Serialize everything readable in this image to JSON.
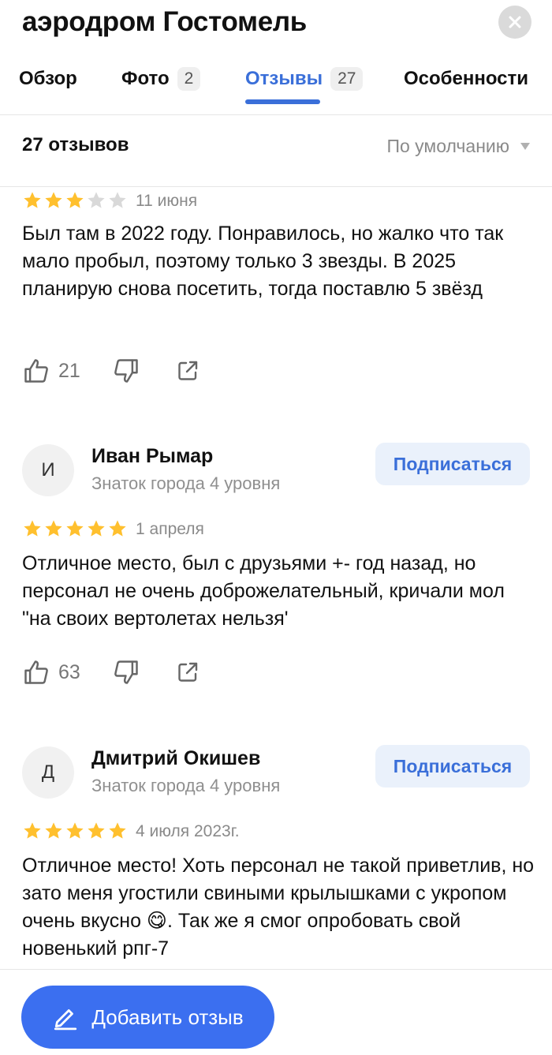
{
  "header": {
    "title": "аэродром Гостомель",
    "tabs": [
      {
        "label": "Обзор",
        "count": ""
      },
      {
        "label": "Фото",
        "count": "2"
      },
      {
        "label": "Отзывы",
        "count": "27"
      },
      {
        "label": "Особенности",
        "count": ""
      }
    ],
    "active_tab": "Отзывы"
  },
  "summary": {
    "reviews_count": "27 отзывов",
    "sort_label": "По умолчанию"
  },
  "reviews": [
    {
      "author": "",
      "level": "",
      "rating": 3,
      "date": "11 июня",
      "text": "Был там в 2022 году. Понравилось, но жалко что так мало пробыл, поэтому только 3 звезды. В 2025 планирую снова посетить, тогда поставлю 5 звёзд",
      "likes": "21"
    },
    {
      "author": "Иван Рымар",
      "initial": "И",
      "level": "Знаток города 4 уровня",
      "subscribe": "Подписаться",
      "rating": 5,
      "date": "1 апреля",
      "text": "Отличное место, был с друзьями +- год назад, но персонал не очень доброжелательный, кричали мол \"на своих вертолетах нельзя'",
      "likes": "63"
    },
    {
      "author": "Дмитрий Окишев",
      "initial": "Д",
      "level": "Знаток города 4 уровня",
      "subscribe": "Подписаться",
      "rating": 5,
      "date": "4 июля 2023г.",
      "text": "Отличное место! Хоть персонал не такой приветлив, но зато меня угостили свиными крылышками с укропом очень вкусно 😋. Так же я смог опробовать свой новенький рпг-7",
      "likes": ""
    }
  ],
  "footer": {
    "add_review_label": "Добавить отзыв"
  },
  "colors": {
    "accent": "#3a6fd9",
    "star_filled": "#ffc02e",
    "star_empty": "#d9d9d9",
    "button_primary": "#3b6ff0"
  }
}
